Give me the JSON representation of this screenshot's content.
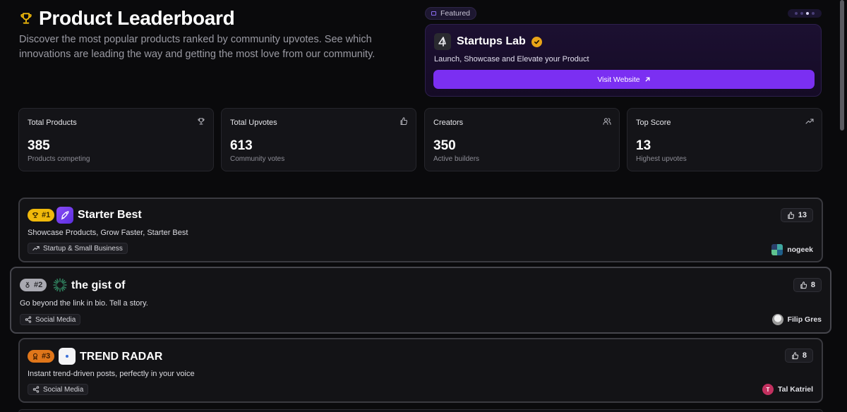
{
  "header": {
    "title": "Product Leaderboard",
    "subtitle": "Discover the most popular products ranked by community upvotes. See which innovations are leading the way and getting the most love from our community."
  },
  "featured": {
    "chip_label": "Featured",
    "name": "Startups Lab",
    "tagline": "Launch, Showcase and Elevate your Product",
    "button_label": "Visit Website"
  },
  "stats": [
    {
      "label": "Total Products",
      "value": "385",
      "sub": "Products competing",
      "icon": "trophy-icon"
    },
    {
      "label": "Total Upvotes",
      "value": "613",
      "sub": "Community votes",
      "icon": "thumbs-up-icon"
    },
    {
      "label": "Creators",
      "value": "350",
      "sub": "Active builders",
      "icon": "users-icon"
    },
    {
      "label": "Top Score",
      "value": "13",
      "sub": "Highest upvotes",
      "icon": "trending-up-icon"
    }
  ],
  "leaderboard": [
    {
      "rank": "#1",
      "name": "Starter Best",
      "description": "Showcase Products, Grow Faster, Starter Best",
      "category": "Startup & Small Business",
      "upvotes": "13",
      "creator": "nogeek"
    },
    {
      "rank": "#2",
      "name": "the gist of",
      "description": "Go beyond the link in bio. Tell a story.",
      "category": "Social Media",
      "upvotes": "8",
      "creator": "Filip Gres"
    },
    {
      "rank": "#3",
      "name": "TREND RADAR",
      "description": "Instant trend-driven posts, perfectly in your voice",
      "category": "Social Media",
      "upvotes": "8",
      "creator": "Tal Katriel",
      "creator_initial": "T"
    }
  ],
  "colors": {
    "background": "#0a0a0c",
    "accent": "#7b2ff2",
    "gold": "#f0b90b",
    "silver": "#a9a9b1",
    "bronze": "#e0761a"
  }
}
